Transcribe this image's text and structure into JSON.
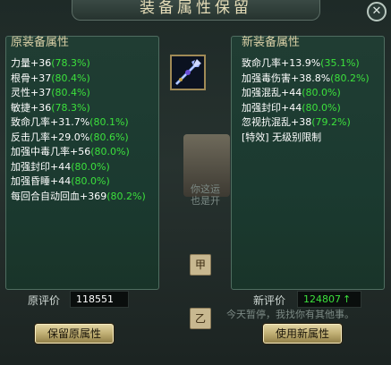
{
  "dialog": {
    "title": "装备属性保留",
    "close_symbol": "✕"
  },
  "original": {
    "heading": "原装备属性",
    "attributes": [
      {
        "text": "力量+36",
        "pct": "(78.3%)"
      },
      {
        "text": "根骨+37",
        "pct": "(80.4%)"
      },
      {
        "text": "灵性+37",
        "pct": "(80.4%)"
      },
      {
        "text": "敏捷+36",
        "pct": "(78.3%)"
      },
      {
        "text": "致命几率+31.7%",
        "pct": "(80.1%)"
      },
      {
        "text": "反击几率+29.0%",
        "pct": "(80.6%)"
      },
      {
        "text": "加强中毒几率+56",
        "pct": "(80.0%)"
      },
      {
        "text": "加强封印+44",
        "pct": "(80.0%)"
      },
      {
        "text": "加强昏睡+44",
        "pct": "(80.0%)"
      },
      {
        "text": "每回合自动回血+369",
        "pct": "(80.2%)"
      }
    ],
    "score_label": "原评价",
    "score_value": "118551",
    "button_label": "保留原属性"
  },
  "new": {
    "heading": "新装备属性",
    "attributes": [
      {
        "text": "致命几率+13.9%",
        "pct": "(35.1%)"
      },
      {
        "text": "加强毒伤害+38.8%",
        "pct": "(80.2%)"
      },
      {
        "text": "加强混乱+44",
        "pct": "(80.0%)"
      },
      {
        "text": "加强封印+44",
        "pct": "(80.0%)"
      },
      {
        "text": "忽视抗混乱+38",
        "pct": "(79.2%)"
      },
      {
        "text": "[特效] 无级别限制",
        "pct": ""
      }
    ],
    "score_label": "新评价",
    "score_value": "124807",
    "score_arrow": "↑",
    "button_label": "使用新属性"
  },
  "background": {
    "npc_line1": "你这运",
    "npc_line2": "也是开",
    "chat_tag_1": "甲",
    "chat_tag_2": "乙",
    "chat_text": "今天暂停，我找你有其他事。"
  },
  "colors": {
    "percent_green": "#3ce03c",
    "heading_gold": "#d9cfa6",
    "button_gold": "#bfae73"
  },
  "icons": {
    "item": "weapon-trident-icon",
    "close": "close-icon",
    "score_up": "arrow-up-icon"
  }
}
